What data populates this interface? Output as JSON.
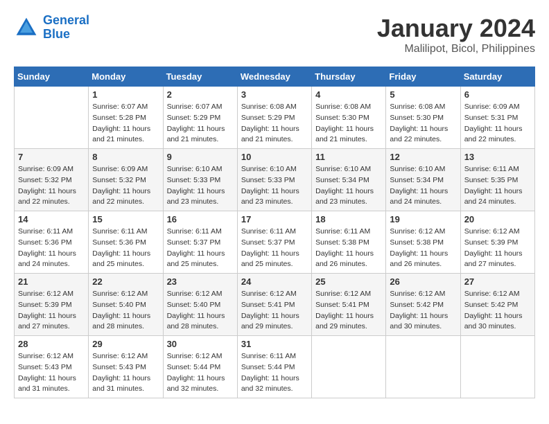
{
  "header": {
    "logo_line1": "General",
    "logo_line2": "Blue",
    "title": "January 2024",
    "subtitle": "Malilipot, Bicol, Philippines"
  },
  "days_of_week": [
    "Sunday",
    "Monday",
    "Tuesday",
    "Wednesday",
    "Thursday",
    "Friday",
    "Saturday"
  ],
  "weeks": [
    {
      "days": [
        {
          "num": "",
          "empty": true
        },
        {
          "num": "1",
          "sunrise": "6:07 AM",
          "sunset": "5:28 PM",
          "daylight": "11 hours and 21 minutes."
        },
        {
          "num": "2",
          "sunrise": "6:07 AM",
          "sunset": "5:29 PM",
          "daylight": "11 hours and 21 minutes."
        },
        {
          "num": "3",
          "sunrise": "6:08 AM",
          "sunset": "5:29 PM",
          "daylight": "11 hours and 21 minutes."
        },
        {
          "num": "4",
          "sunrise": "6:08 AM",
          "sunset": "5:30 PM",
          "daylight": "11 hours and 21 minutes."
        },
        {
          "num": "5",
          "sunrise": "6:08 AM",
          "sunset": "5:30 PM",
          "daylight": "11 hours and 22 minutes."
        },
        {
          "num": "6",
          "sunrise": "6:09 AM",
          "sunset": "5:31 PM",
          "daylight": "11 hours and 22 minutes."
        }
      ]
    },
    {
      "days": [
        {
          "num": "7",
          "sunrise": "6:09 AM",
          "sunset": "5:32 PM",
          "daylight": "11 hours and 22 minutes."
        },
        {
          "num": "8",
          "sunrise": "6:09 AM",
          "sunset": "5:32 PM",
          "daylight": "11 hours and 22 minutes."
        },
        {
          "num": "9",
          "sunrise": "6:10 AM",
          "sunset": "5:33 PM",
          "daylight": "11 hours and 23 minutes."
        },
        {
          "num": "10",
          "sunrise": "6:10 AM",
          "sunset": "5:33 PM",
          "daylight": "11 hours and 23 minutes."
        },
        {
          "num": "11",
          "sunrise": "6:10 AM",
          "sunset": "5:34 PM",
          "daylight": "11 hours and 23 minutes."
        },
        {
          "num": "12",
          "sunrise": "6:10 AM",
          "sunset": "5:34 PM",
          "daylight": "11 hours and 24 minutes."
        },
        {
          "num": "13",
          "sunrise": "6:11 AM",
          "sunset": "5:35 PM",
          "daylight": "11 hours and 24 minutes."
        }
      ]
    },
    {
      "days": [
        {
          "num": "14",
          "sunrise": "6:11 AM",
          "sunset": "5:36 PM",
          "daylight": "11 hours and 24 minutes."
        },
        {
          "num": "15",
          "sunrise": "6:11 AM",
          "sunset": "5:36 PM",
          "daylight": "11 hours and 25 minutes."
        },
        {
          "num": "16",
          "sunrise": "6:11 AM",
          "sunset": "5:37 PM",
          "daylight": "11 hours and 25 minutes."
        },
        {
          "num": "17",
          "sunrise": "6:11 AM",
          "sunset": "5:37 PM",
          "daylight": "11 hours and 25 minutes."
        },
        {
          "num": "18",
          "sunrise": "6:11 AM",
          "sunset": "5:38 PM",
          "daylight": "11 hours and 26 minutes."
        },
        {
          "num": "19",
          "sunrise": "6:12 AM",
          "sunset": "5:38 PM",
          "daylight": "11 hours and 26 minutes."
        },
        {
          "num": "20",
          "sunrise": "6:12 AM",
          "sunset": "5:39 PM",
          "daylight": "11 hours and 27 minutes."
        }
      ]
    },
    {
      "days": [
        {
          "num": "21",
          "sunrise": "6:12 AM",
          "sunset": "5:39 PM",
          "daylight": "11 hours and 27 minutes."
        },
        {
          "num": "22",
          "sunrise": "6:12 AM",
          "sunset": "5:40 PM",
          "daylight": "11 hours and 28 minutes."
        },
        {
          "num": "23",
          "sunrise": "6:12 AM",
          "sunset": "5:40 PM",
          "daylight": "11 hours and 28 minutes."
        },
        {
          "num": "24",
          "sunrise": "6:12 AM",
          "sunset": "5:41 PM",
          "daylight": "11 hours and 29 minutes."
        },
        {
          "num": "25",
          "sunrise": "6:12 AM",
          "sunset": "5:41 PM",
          "daylight": "11 hours and 29 minutes."
        },
        {
          "num": "26",
          "sunrise": "6:12 AM",
          "sunset": "5:42 PM",
          "daylight": "11 hours and 30 minutes."
        },
        {
          "num": "27",
          "sunrise": "6:12 AM",
          "sunset": "5:42 PM",
          "daylight": "11 hours and 30 minutes."
        }
      ]
    },
    {
      "days": [
        {
          "num": "28",
          "sunrise": "6:12 AM",
          "sunset": "5:43 PM",
          "daylight": "11 hours and 31 minutes."
        },
        {
          "num": "29",
          "sunrise": "6:12 AM",
          "sunset": "5:43 PM",
          "daylight": "11 hours and 31 minutes."
        },
        {
          "num": "30",
          "sunrise": "6:12 AM",
          "sunset": "5:44 PM",
          "daylight": "11 hours and 32 minutes."
        },
        {
          "num": "31",
          "sunrise": "6:11 AM",
          "sunset": "5:44 PM",
          "daylight": "11 hours and 32 minutes."
        },
        {
          "num": "",
          "empty": true
        },
        {
          "num": "",
          "empty": true
        },
        {
          "num": "",
          "empty": true
        }
      ]
    }
  ]
}
